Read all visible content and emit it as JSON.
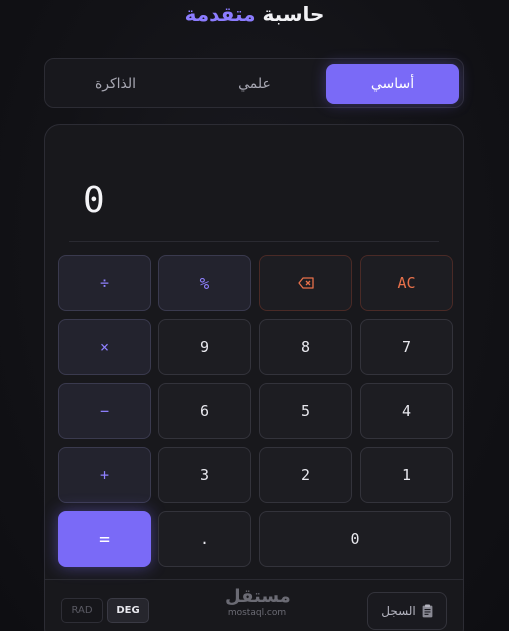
{
  "title": {
    "part1": "حاسبة",
    "part2": "متقدمة"
  },
  "tabs": {
    "basic": "أساسي",
    "scientific": "علمي",
    "memory": "الذاكرة",
    "active": "basic"
  },
  "display": {
    "value": "0"
  },
  "keys": {
    "clear": "AC",
    "backspace_icon": "backspace-icon",
    "percent": "%",
    "divide": "÷",
    "seven": "7",
    "eight": "8",
    "nine": "9",
    "multiply": "×",
    "four": "4",
    "five": "5",
    "six": "6",
    "minus": "−",
    "one": "1",
    "two": "2",
    "three": "3",
    "plus": "+",
    "zero": "0",
    "decimal": ".",
    "equals": "="
  },
  "footer": {
    "history_label": "السجل",
    "history_icon": "clipboard-icon",
    "brand_main": "مستقل",
    "brand_sub": "mostaql.com",
    "mode_rad": "RAD",
    "mode_deg": "DEG",
    "active_mode": "DEG"
  },
  "colors": {
    "accent": "#7a6af7",
    "danger": "#e7704a",
    "background": "#121216"
  }
}
